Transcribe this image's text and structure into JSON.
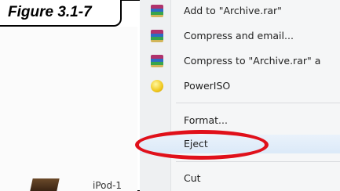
{
  "figure": {
    "label": "Figure 3.1-7"
  },
  "context_menu": {
    "items": [
      {
        "label": "Add to \"Archive.rar\"",
        "icon": "winrar-icon"
      },
      {
        "label": "Compress and email...",
        "icon": "winrar-icon"
      },
      {
        "label": "Compress to \"Archive.rar\" a",
        "icon": "winrar-icon"
      },
      {
        "label": "PowerISO",
        "icon": "poweriso-icon"
      },
      {
        "label": "Format...",
        "icon": ""
      },
      {
        "label": "Eject",
        "icon": ""
      },
      {
        "label": "Cut",
        "icon": ""
      }
    ]
  },
  "background": {
    "partial_label": "iPod-1"
  },
  "colors": {
    "highlight_ellipse": "#e0101a",
    "menu_bg": "#f5f6f7"
  }
}
